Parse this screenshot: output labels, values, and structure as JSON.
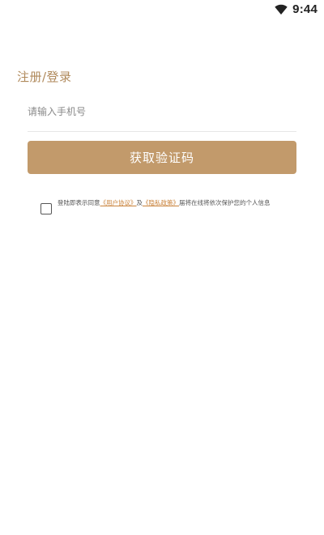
{
  "status_bar": {
    "time": "9:44",
    "wifi_icon": "wifi-icon"
  },
  "page": {
    "title": "注册/登录"
  },
  "phone_field": {
    "placeholder": "请输入手机号",
    "value": ""
  },
  "get_code_button": {
    "label": "获取验证码"
  },
  "agreement": {
    "checked": false,
    "prefix": "登陆即表示同意",
    "user_agreement_link": "《用户协议》",
    "conjunction": "及",
    "privacy_policy_link": "《隐私政策》",
    "suffix": "届将在线将依次保护您的个人信息"
  },
  "colors": {
    "accent": "#c29a6b",
    "title": "#b08a5c",
    "link": "#c9823a"
  }
}
